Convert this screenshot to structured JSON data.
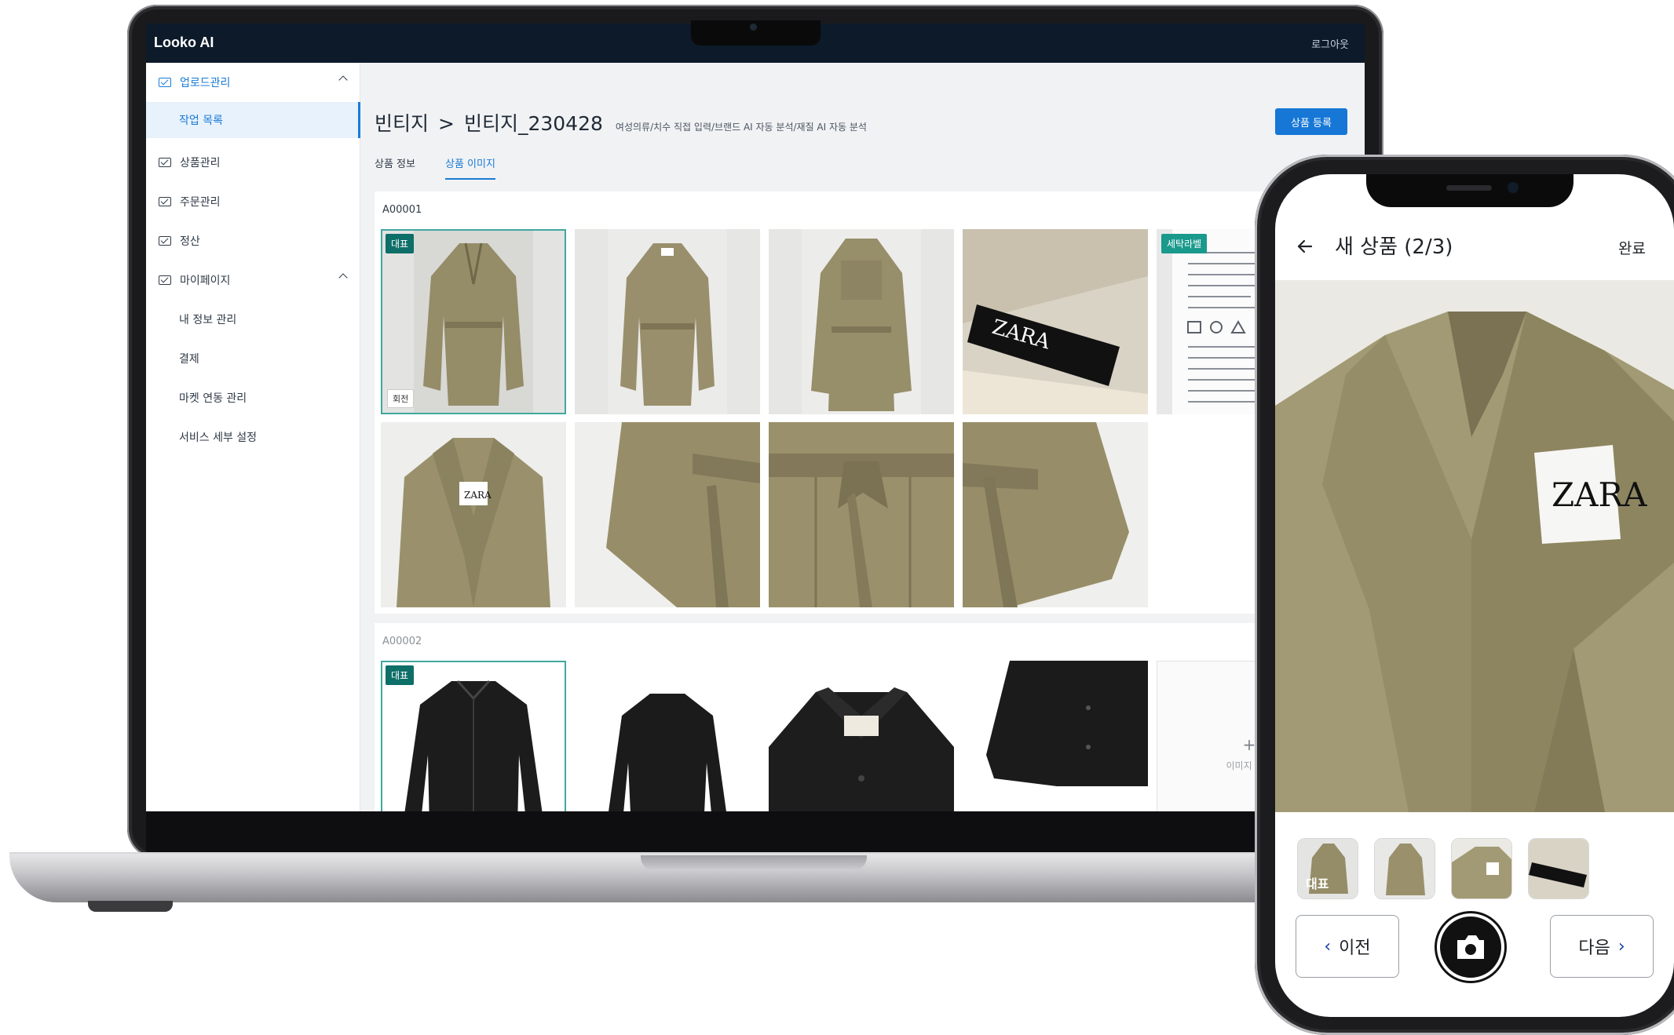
{
  "laptop": {
    "app_title": "Looko AI",
    "logout": "로그아웃",
    "sidebar": {
      "upload_group": "업로드관리",
      "job_list": "작업 목록",
      "product_mgmt": "상품관리",
      "order_mgmt": "주문관리",
      "settlement": "정산",
      "mypage_group": "마이페이지",
      "my_info": "내 정보 관리",
      "payment": "결제",
      "market_link": "마켓 연동 관리",
      "service_settings": "서비스 세부 설정"
    },
    "breadcrumb": {
      "root": "빈티지",
      "sep": ">",
      "current": "빈티지_230428",
      "subtitle": "여성의류/치수 직접 입력/브랜드 AI 자동 분석/재질 AI 자동 분석"
    },
    "register_button": "상품 등록",
    "tabs": [
      "상품 정보",
      "상품 이미지"
    ],
    "groups": [
      {
        "id": "A00001",
        "rep_badge": "대표",
        "rotate_label": "회전",
        "care_label_badge": "세탁라벨"
      },
      {
        "id": "A00002",
        "rep_badge": "대표",
        "add_image": "이미지 추가",
        "add_plus": "+"
      }
    ]
  },
  "phone": {
    "title": "새 상품 (2/3)",
    "done": "완료",
    "thumb_rep": "대표",
    "prev": "이전",
    "next": "다음",
    "prev_icon": "‹",
    "next_icon": "›",
    "photo_brand": "ZARA"
  },
  "brand": "ZARA",
  "colors": {
    "accent": "#1677d6",
    "badge": "#0e6e68",
    "coat": "#9c9470",
    "dark_item": "#1c1c1c"
  }
}
